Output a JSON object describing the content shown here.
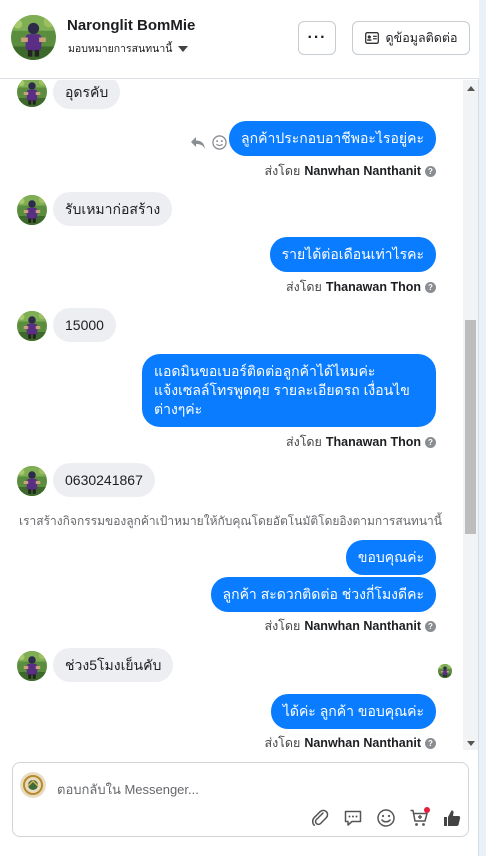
{
  "header": {
    "name": "Naronglit BomMie",
    "assign_label": "มอบหมายการสนทนานี้",
    "more_label": "···",
    "contact_label": "ดูข้อมูลติดต่อ"
  },
  "messages": {
    "m1": "อุดรคับ",
    "m2": "ลูกค้าประกอบอาชีพอะไรอยู่คะ",
    "m3": "รับเหมาก่อสร้าง",
    "m4": "รายได้ต่อเดือนเท่าไรคะ",
    "m5": "15000",
    "m6_line1": "แอดมินขอเบอร์ติดต่อลูกค้าได้ไหมค่ะ",
    "m6_line2": "แจ้งเซลล์โทรพูดคุย รายละเอียดรถ เงื่อนไข",
    "m6_line3": "ต่างๆค่ะ",
    "m7": "0630241867",
    "notice": "เราสร้างกิจกรรมของลูกค้าเป้าหมายให้กับคุณโดยอัตโนมัติโดยอิงตามการสนทนานี้",
    "m8": "ขอบคุณค่ะ",
    "m9": "ลูกค้า สะดวกติดต่อ ช่วงกี่โมงดีคะ",
    "m10": "ช่วง5โมงเย็นคับ",
    "m11": "ได้ค่ะ ลูกค้า ขอบคุณค่ะ"
  },
  "sent_by": {
    "prefix": "ส่งโดย",
    "s1": "Nanwhan Nanthanit",
    "s2": "Thanawan Thon",
    "s3": "Thanawan Thon",
    "s4": "Nanwhan Nanthanit",
    "s5": "Nanwhan Nanthanit",
    "help": "?"
  },
  "composer": {
    "placeholder": "ตอบกลับใน Messenger..."
  },
  "icons": {
    "reply": "reply-icon",
    "emoji": "emoji-icon",
    "attach": "attach-icon",
    "saved_replies": "saved-replies-icon",
    "cart": "cart-icon",
    "like": "thumbs-up-icon"
  },
  "colors": {
    "outgoing": "#0a7cff",
    "incoming": "#eceef1",
    "background": "#e9f3f7"
  }
}
